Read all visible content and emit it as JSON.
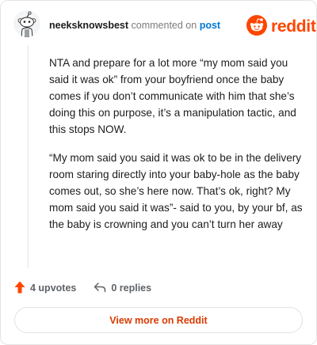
{
  "comment": {
    "username": "neeksknowsbest",
    "action_text": "commented on",
    "post_link": "post",
    "paragraphs": [
      "NTA and prepare for a lot more “my mom said you said it was ok” from your boyfriend once the baby comes if you don’t communicate with him that she’s doing this on purpose, it’s a manipulation tactic, and this stops NOW.",
      "“My mom said you said it was ok to be in the delivery room staring directly into your baby-hole as the baby comes out, so she’s here now. That’s ok, right? My mom said you said it was”- said to you, by your bf, as the baby is crowning and you can’t turn her away"
    ]
  },
  "brand": {
    "logo_text": "reddit",
    "color": "#ff4500"
  },
  "actions": {
    "upvotes_label": "4 upvotes",
    "replies_label": "0 replies",
    "upvote_color": "#ff4500"
  },
  "footer": {
    "view_more_label": "View more on Reddit"
  },
  "icons": [
    "user-avatar",
    "reddit-logo-icon",
    "upvote-arrow-icon",
    "reply-arrow-icon"
  ]
}
